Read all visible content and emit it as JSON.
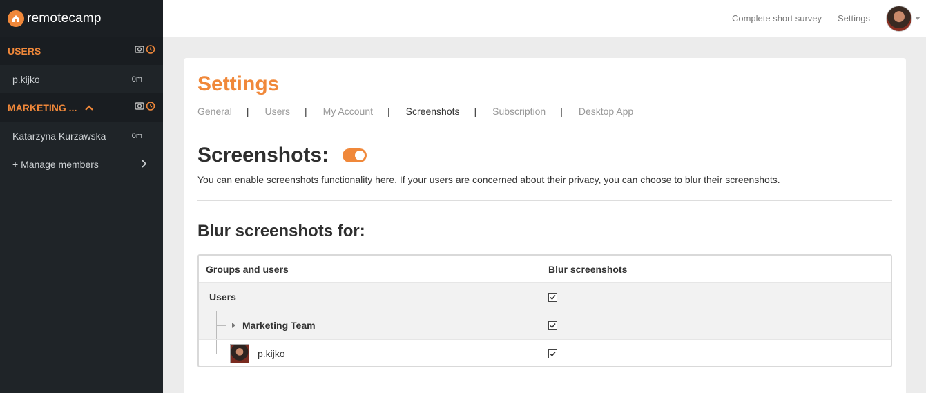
{
  "app": {
    "name": "remotecamp"
  },
  "topbar": {
    "survey_link": "Complete short survey",
    "settings_link": "Settings"
  },
  "sidebar": {
    "groups": [
      {
        "title": "USERS",
        "members": [
          {
            "name": "p.kijko",
            "time": "0m"
          }
        ]
      },
      {
        "title": "MARKETING ...",
        "members": [
          {
            "name": "Katarzyna Kurzawska",
            "time": "0m"
          }
        ]
      }
    ],
    "manage_members": "+ Manage members"
  },
  "page": {
    "title": "Settings",
    "tabs": [
      {
        "label": "General"
      },
      {
        "label": "Users"
      },
      {
        "label": "My Account"
      },
      {
        "label": "Screenshots"
      },
      {
        "label": "Subscription"
      },
      {
        "label": "Desktop App"
      }
    ],
    "separator": "|",
    "active_tab": "Screenshots"
  },
  "screenshots": {
    "title": "Screenshots:",
    "enabled": true,
    "description": "You can enable screenshots functionality here. If your users are concerned about their privacy, you can choose to blur their screenshots.",
    "blur_title": "Blur screenshots for:",
    "table": {
      "headers": [
        "Groups and users",
        "Blur screenshots"
      ],
      "rows": [
        {
          "label": "Users",
          "checked": true
        },
        {
          "label": "Marketing Team",
          "checked": true
        },
        {
          "label": "p.kijko",
          "checked": true
        }
      ]
    }
  },
  "colors": {
    "accent": "#f0883a",
    "sidebar": "#1f2428"
  }
}
